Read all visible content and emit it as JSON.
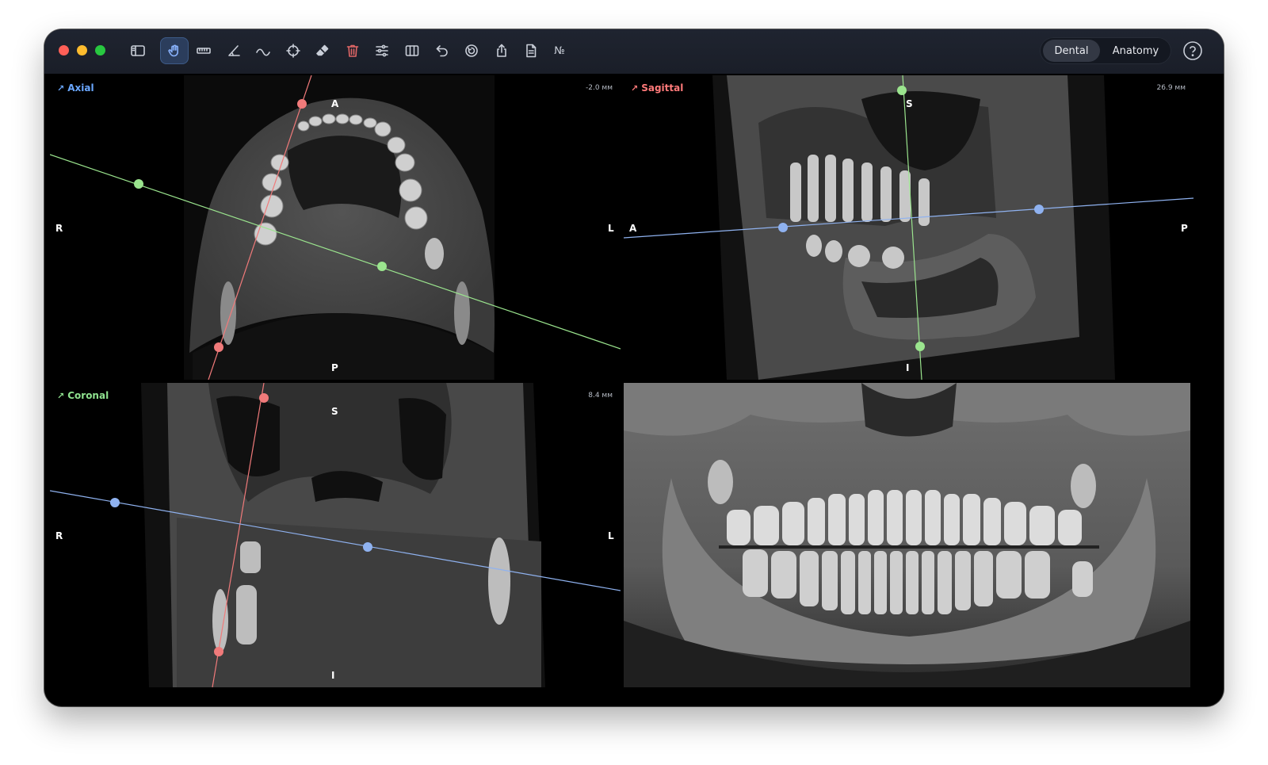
{
  "toolbar": {
    "tools": [
      {
        "name": "sidebar-toggle",
        "label": "Toggle sidebar"
      },
      {
        "name": "pan-tool",
        "label": "Pan / Hand"
      },
      {
        "name": "ruler-tool",
        "label": "Measure length"
      },
      {
        "name": "angle-tool",
        "label": "Measure angle"
      },
      {
        "name": "curve-tool",
        "label": "Curve"
      },
      {
        "name": "crosshair-tool",
        "label": "Crosshair"
      },
      {
        "name": "eraser-tool",
        "label": "Eraser"
      },
      {
        "name": "delete-tool",
        "label": "Delete"
      },
      {
        "name": "adjust-tool",
        "label": "Adjust"
      },
      {
        "name": "layout-tool",
        "label": "Layout"
      },
      {
        "name": "undo-tool",
        "label": "Undo"
      },
      {
        "name": "rotate-tool",
        "label": "Rotate"
      },
      {
        "name": "share-tool",
        "label": "Share"
      },
      {
        "name": "report-tool",
        "label": "Report"
      }
    ],
    "number_glyph": "№"
  },
  "mode_switch": {
    "options": [
      "Dental",
      "Anatomy"
    ],
    "selected": "Dental"
  },
  "views": {
    "axial": {
      "title": "Axial",
      "depth": "-2.0 мм",
      "orient_top": "A",
      "orient_bottom": "P",
      "orient_left": "R",
      "orient_right": "L",
      "accent": "#6aa7ff"
    },
    "sagittal": {
      "title": "Sagittal",
      "depth": "26.9 мм",
      "orient_top": "S",
      "orient_bottom": "I",
      "orient_left": "A",
      "orient_right": "P",
      "accent": "#ff7a7a"
    },
    "coronal": {
      "title": "Coronal",
      "depth": "8.4 мм",
      "orient_top": "S",
      "orient_bottom": "I",
      "orient_left": "R",
      "orient_right": "L",
      "accent": "#8fe28f"
    },
    "panoramic": {
      "title": ""
    }
  },
  "colors": {
    "red_line": "#f07a7a",
    "green_line": "#9be58e",
    "blue_line": "#8fb2f0",
    "titlebar": "#1c202a"
  }
}
